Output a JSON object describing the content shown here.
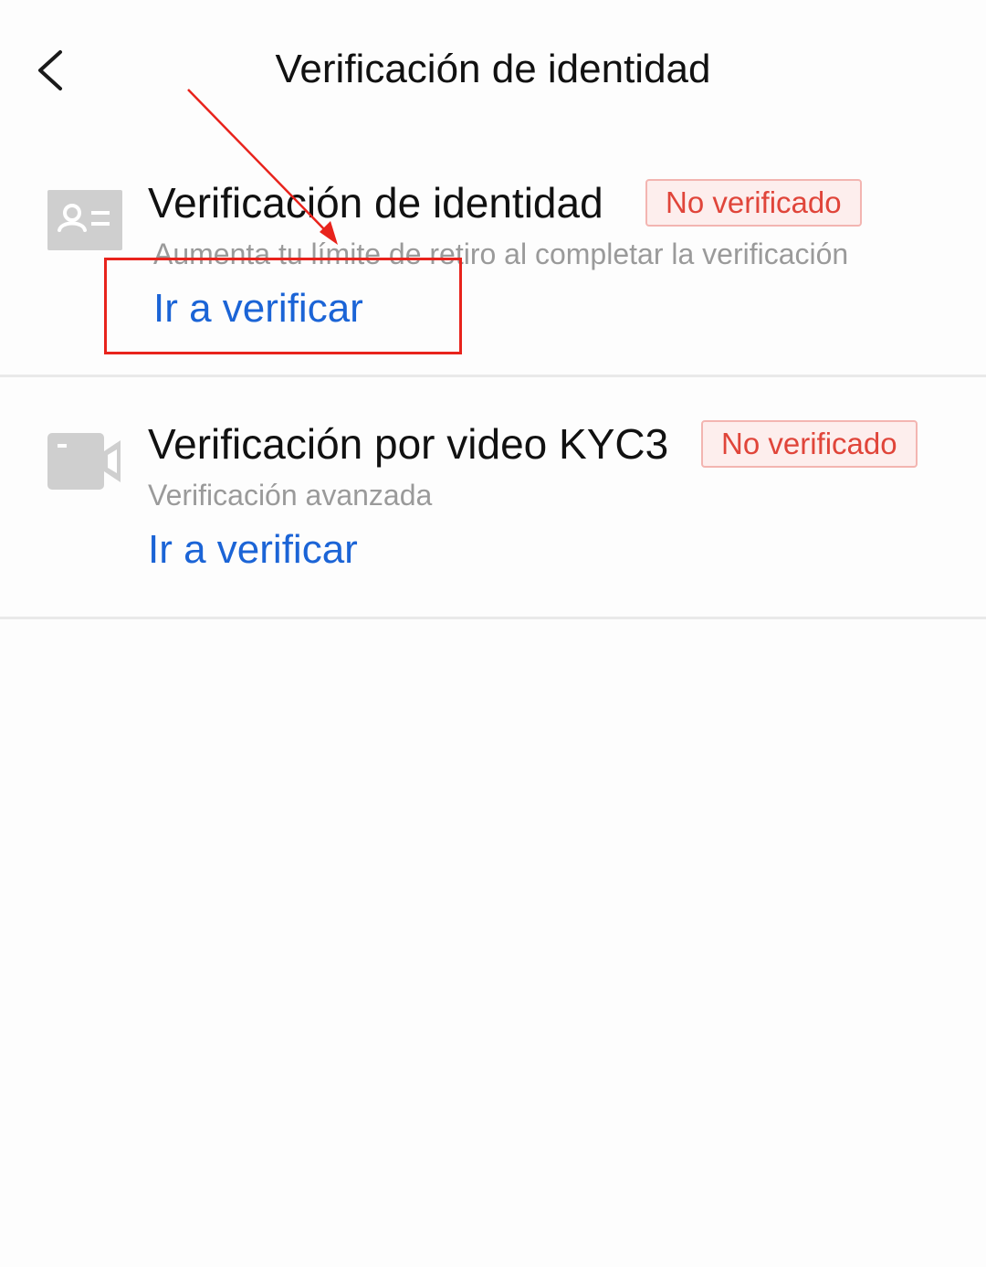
{
  "header": {
    "title": "Verificación de identidad",
    "back_icon": "chevron-left-icon"
  },
  "items": [
    {
      "icon": "id-card-icon",
      "title": "Verificación de identidad",
      "badge": "No verificado",
      "description": "Aumenta tu límite de retiro al completar la verificación",
      "action": "Ir a verificar"
    },
    {
      "icon": "video-camera-icon",
      "title": "Verificación por video KYC3",
      "badge": "No verificado",
      "description": "Verificación avanzada",
      "action": "Ir a verificar"
    }
  ],
  "colors": {
    "background": "#fdfdfd",
    "title_text": "#111111",
    "secondary_text": "#9a9a9a",
    "link": "#1b64d6",
    "badge_text": "#e0453a",
    "badge_bg": "#fdeeed",
    "badge_border": "#f3b5b1",
    "icon_gray": "#cfcfcf",
    "annotation_red": "#e8231c",
    "divider": "#e9e9e9"
  }
}
